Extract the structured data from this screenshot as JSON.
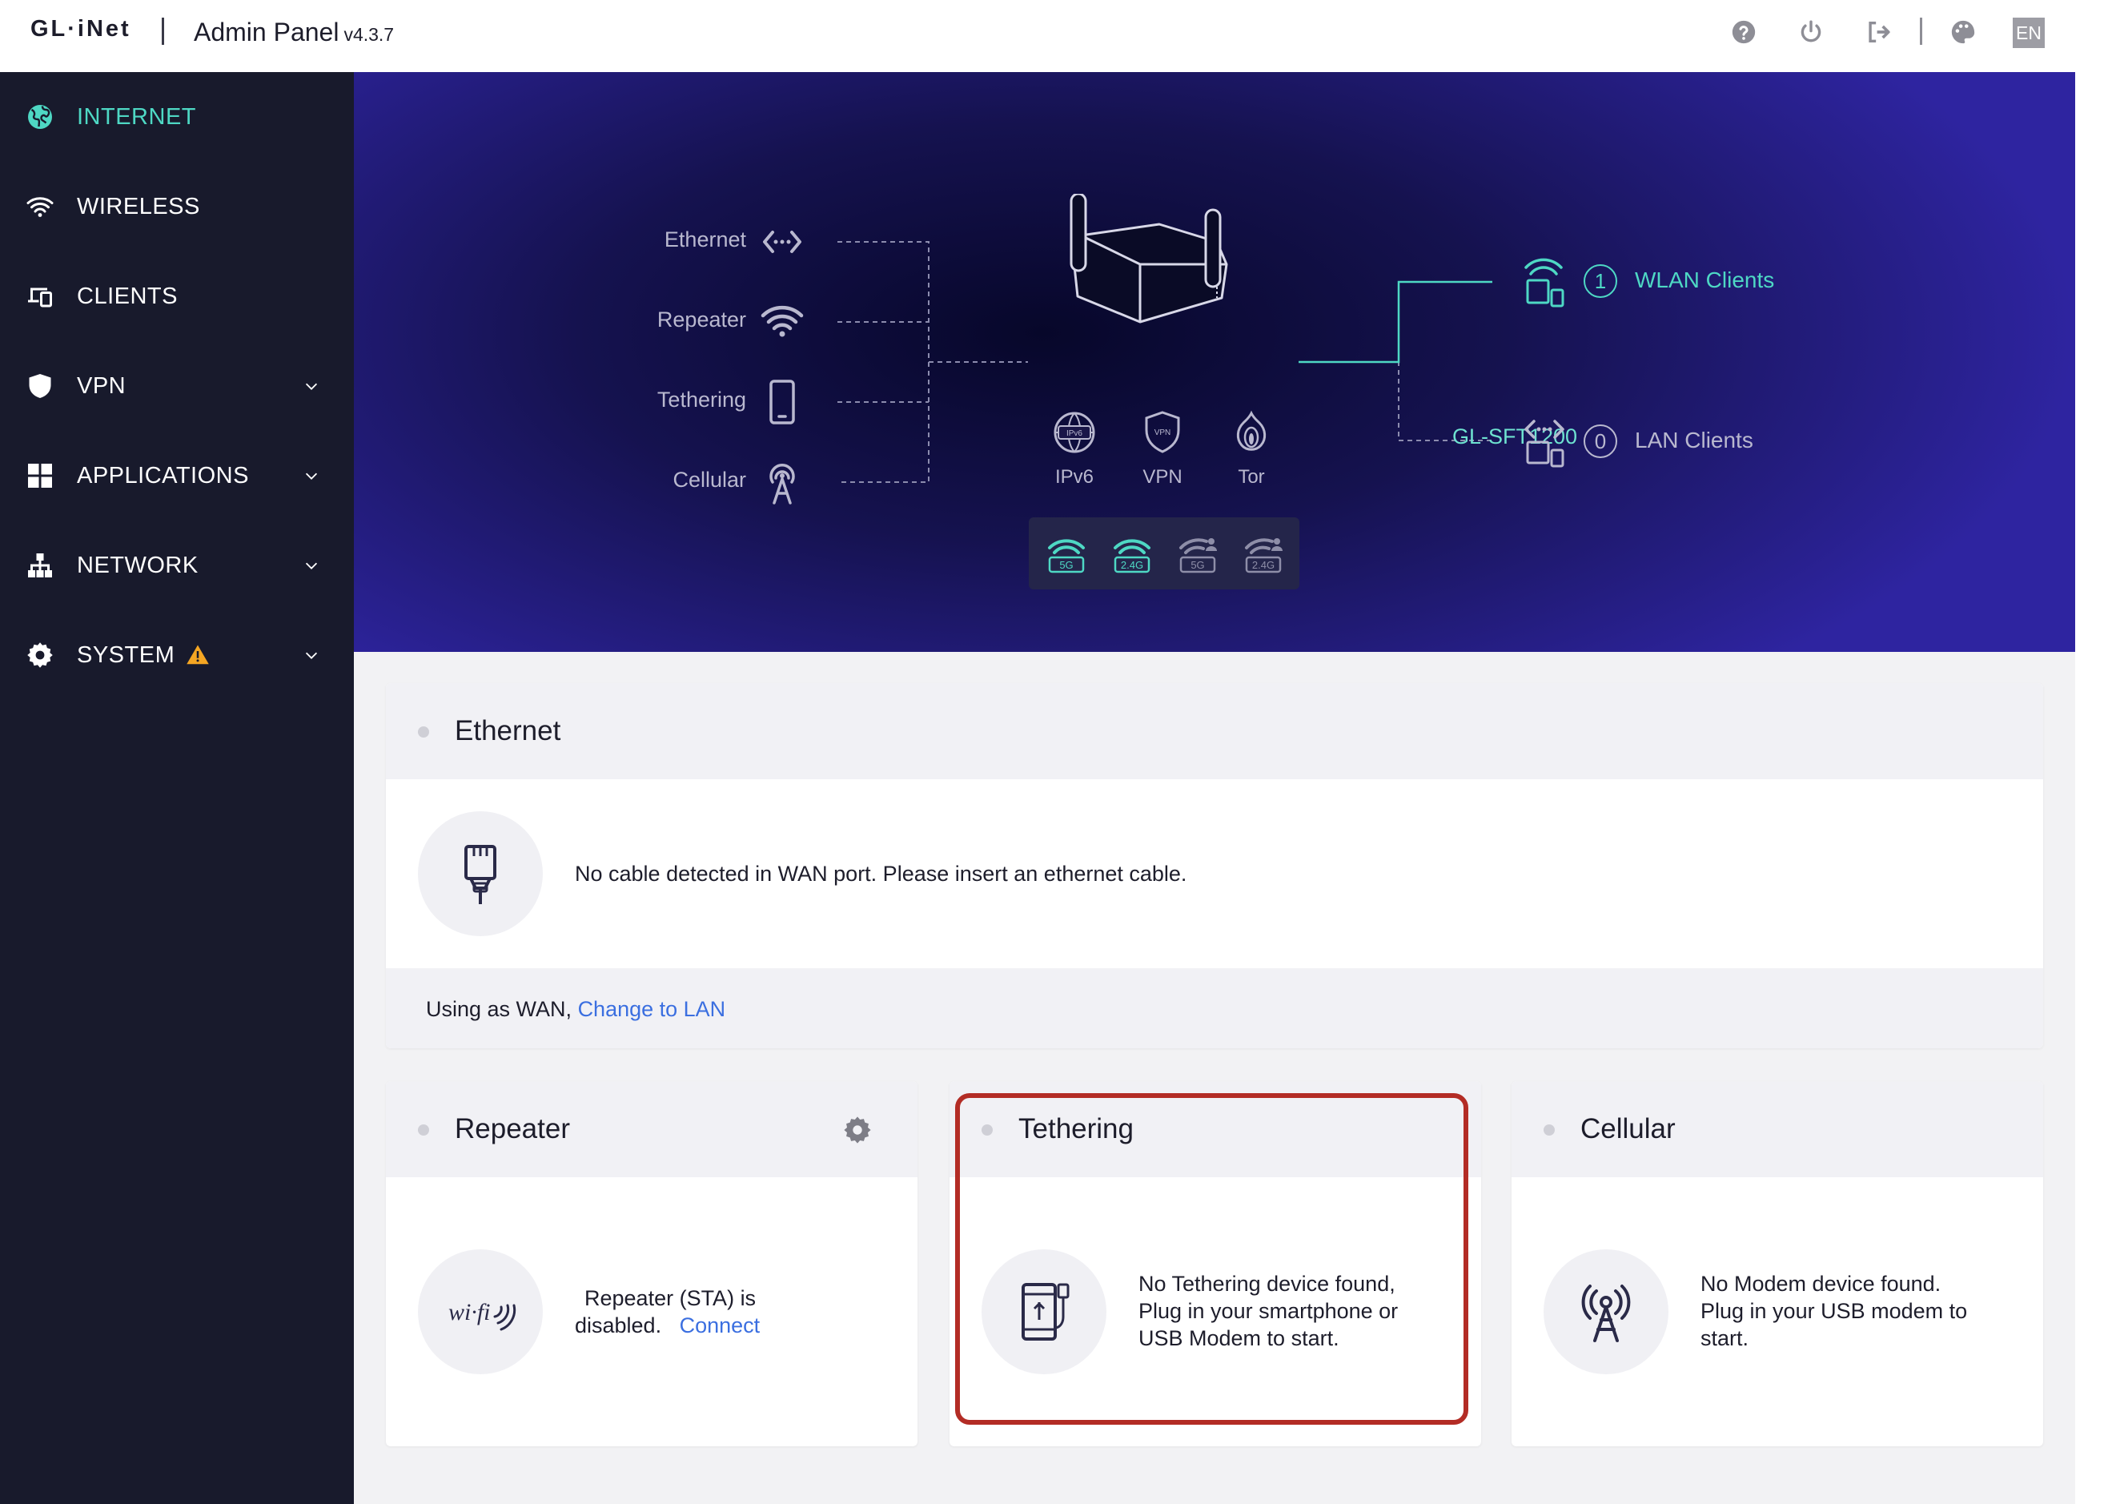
{
  "header": {
    "logo": "GL·iNet",
    "app_title": "Admin Panel",
    "version": "v4.3.7",
    "icons": [
      "help-icon",
      "power-icon",
      "logout-icon",
      "palette-icon"
    ],
    "language": "EN"
  },
  "sidebar": {
    "items": [
      {
        "label": "INTERNET",
        "icon": "globe-icon",
        "active": true
      },
      {
        "label": "WIRELESS",
        "icon": "wifi-icon"
      },
      {
        "label": "CLIENTS",
        "icon": "devices-icon"
      },
      {
        "label": "VPN",
        "icon": "shield-icon",
        "expandable": true
      },
      {
        "label": "APPLICATIONS",
        "icon": "grid-icon",
        "expandable": true
      },
      {
        "label": "NETWORK",
        "icon": "network-icon",
        "expandable": true
      },
      {
        "label": "SYSTEM",
        "icon": "gear-icon",
        "expandable": true,
        "warning": true
      }
    ]
  },
  "topology": {
    "sources": [
      "Ethernet",
      "Repeater",
      "Tethering",
      "Cellular"
    ],
    "device_name": "GL-SFT1200",
    "features": [
      "IPv6",
      "VPN",
      "Tor"
    ],
    "bands": [
      "5G",
      "2.4G",
      "5G",
      "2.4G"
    ],
    "clients": {
      "wlan": {
        "count": "1",
        "label": "WLAN Clients"
      },
      "lan": {
        "count": "0",
        "label": "LAN Clients"
      }
    },
    "colors": {
      "accent": "#4ed8c4",
      "muted": "#b9b8cf"
    }
  },
  "ethernet_card": {
    "title": "Ethernet",
    "message": "No cable detected in WAN port. Please insert an ethernet cable.",
    "footer_prefix": "Using as WAN,",
    "footer_link": "Change to LAN"
  },
  "repeater_card": {
    "title": "Repeater",
    "message_line1": "Repeater (STA) is",
    "message_line2": "disabled.",
    "link": "Connect"
  },
  "tethering_card": {
    "title": "Tethering",
    "message_line1": "No Tethering device found,",
    "message_line2": "Plug in your smartphone or",
    "message_line3": "USB Modem to start."
  },
  "cellular_card": {
    "title": "Cellular",
    "message_line1": "No Modem device found.",
    "message_line2": "Plug in your USB modem to",
    "message_line3": "start."
  },
  "highlight_color": "#b32c25"
}
